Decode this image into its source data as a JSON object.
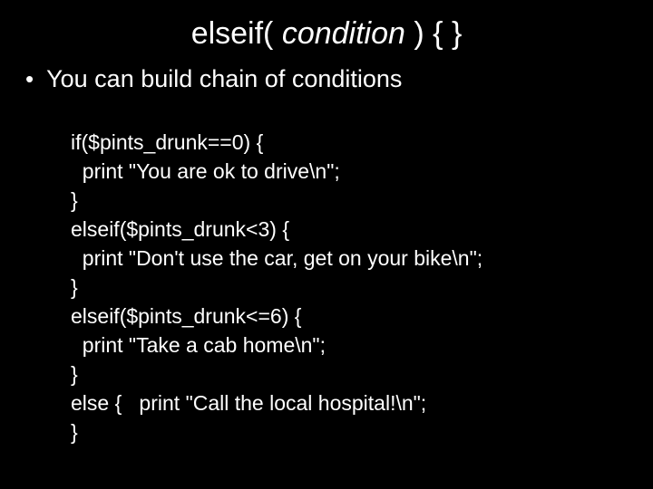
{
  "title_kw1": "elseif( ",
  "title_cond": "condition",
  "title_kw2": " ) { }",
  "bullet": "You can build chain of conditions",
  "code": {
    "l01": "if($pints_drunk==0) {",
    "l02": "  print \"You are ok to drive\\n\";",
    "l03": "}",
    "l04": "elseif($pints_drunk<3) {",
    "l05": "  print \"Don't use the car, get on your bike\\n\";",
    "l06": "}",
    "l07": "elseif($pints_drunk<=6) {",
    "l08": "  print \"Take a cab home\\n\";",
    "l09": "}",
    "l10": "else {   print \"Call the local hospital!\\n\";",
    "l11": "}"
  }
}
